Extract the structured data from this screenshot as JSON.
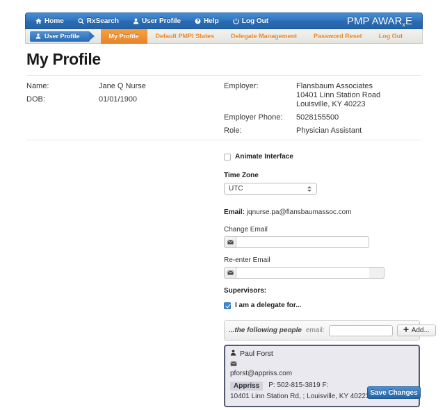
{
  "navbar": {
    "items": [
      {
        "label": "Home",
        "icon": "home-icon"
      },
      {
        "label": "RxSearch",
        "icon": "search-icon"
      },
      {
        "label": "User Profile",
        "icon": "user-icon"
      },
      {
        "label": "Help",
        "icon": "help-circle-icon"
      },
      {
        "label": "Log Out",
        "icon": "power-icon"
      }
    ],
    "brand": "PMP AWAR",
    "brand_sub": "x",
    "brand_tail": "E"
  },
  "subbar": {
    "pill_label": "User Profile",
    "tabs": [
      {
        "label": "My Profile",
        "active": true
      },
      {
        "label": "Default PMPI States",
        "active": false
      },
      {
        "label": "Delegate Management",
        "active": false
      },
      {
        "label": "Password Reset",
        "active": false
      },
      {
        "label": "Log Out",
        "active": false
      }
    ]
  },
  "page_title": "My Profile",
  "profile": {
    "name_label": "Name:",
    "name_value": "Jane Q Nurse",
    "dob_label": "DOB:",
    "dob_value": "01/01/1900",
    "employer_label": "Employer:",
    "employer_line1": "Flansbaum Associates",
    "employer_line2": "10401 Linn Station Road",
    "employer_line3": "Louisville, KY 40223",
    "phone_label": "Employer Phone:",
    "phone_value": "5028155500",
    "role_label": "Role:",
    "role_value": "Physician Assistant"
  },
  "form": {
    "animate_label": "Animate Interface",
    "animate_checked": false,
    "timezone_label": "Time Zone",
    "timezone_value": "UTC",
    "email_prefix": "Email:",
    "email_value": "jqnurse.pa@flansbaumassoc.com",
    "change_email_label": "Change Email",
    "change_email_value": "",
    "change_email_placeholder": "",
    "reenter_email_label": "Re-enter Email",
    "reenter_email_value": "",
    "reenter_email_placeholder": "",
    "supervisors_label": "Supervisors:",
    "delegate_label": "I am a delegate for...",
    "delegate_checked": true,
    "following_people_label": "...the following people",
    "email_small_label": "email:",
    "delegate_email_value": "",
    "delegate_email_placeholder": "",
    "add_button_label": "Add...",
    "add_button_icon": "plus-icon"
  },
  "delegate_card": {
    "name": "Paul Forst",
    "name_icon": "user-icon",
    "mail_icon": "envelope-icon",
    "email": "pforst@appriss.com",
    "organization": "Appriss",
    "phone": "P: 502-815-3819  F:",
    "address": "10401 Linn Station Rd, ;  Louisville, KY 40223"
  },
  "save_button_label": "Save Changes",
  "colors": {
    "nav_blue": "#2a6bb3",
    "tab_orange": "#e8822a",
    "card_border": "#565a72",
    "accent_check": "#3b8ad9"
  }
}
